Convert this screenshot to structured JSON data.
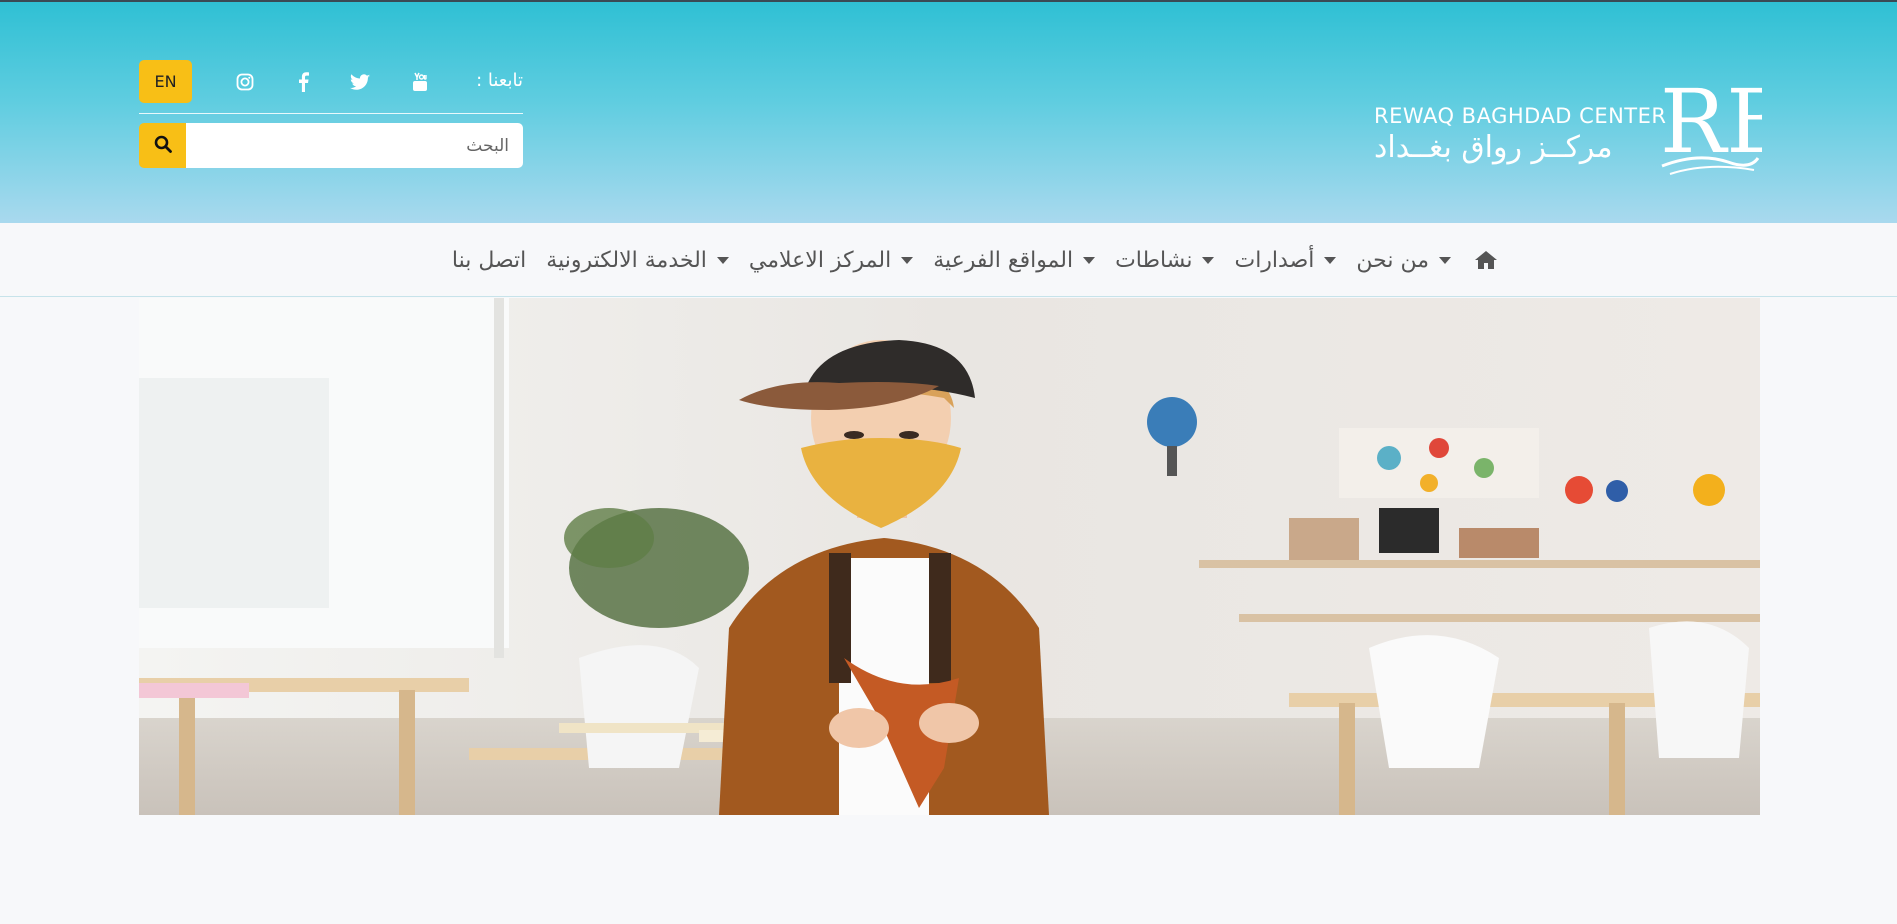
{
  "header": {
    "logo": {
      "latin": "REWAQ BAGHDAD CENTER",
      "arabic": "مركــز رواق بغــداد",
      "mark_text": "RB"
    },
    "language_button": "EN",
    "follow_label": "تابعنا :",
    "social_icons": [
      "instagram-icon",
      "facebook-icon",
      "twitter-icon",
      "youtube-icon"
    ],
    "search": {
      "placeholder": "البحث",
      "value": ""
    }
  },
  "nav": {
    "home_icon": "home-icon",
    "items": [
      {
        "label": "من نحن",
        "dropdown": true
      },
      {
        "label": "أصدارات",
        "dropdown": true
      },
      {
        "label": "نشاطات",
        "dropdown": true
      },
      {
        "label": "المواقع الفرعية",
        "dropdown": true
      },
      {
        "label": "المركز الاعلامي",
        "dropdown": true
      },
      {
        "label": "الخدمة الالكترونية",
        "dropdown": true
      },
      {
        "label": "اتصل بنا",
        "dropdown": false
      }
    ]
  },
  "colors": {
    "accent": "#f8bf16",
    "header_top": "#2fc0d4",
    "header_bottom": "#a9d9ee",
    "nav_text": "#555555",
    "page_bg": "#f7f8fa"
  }
}
